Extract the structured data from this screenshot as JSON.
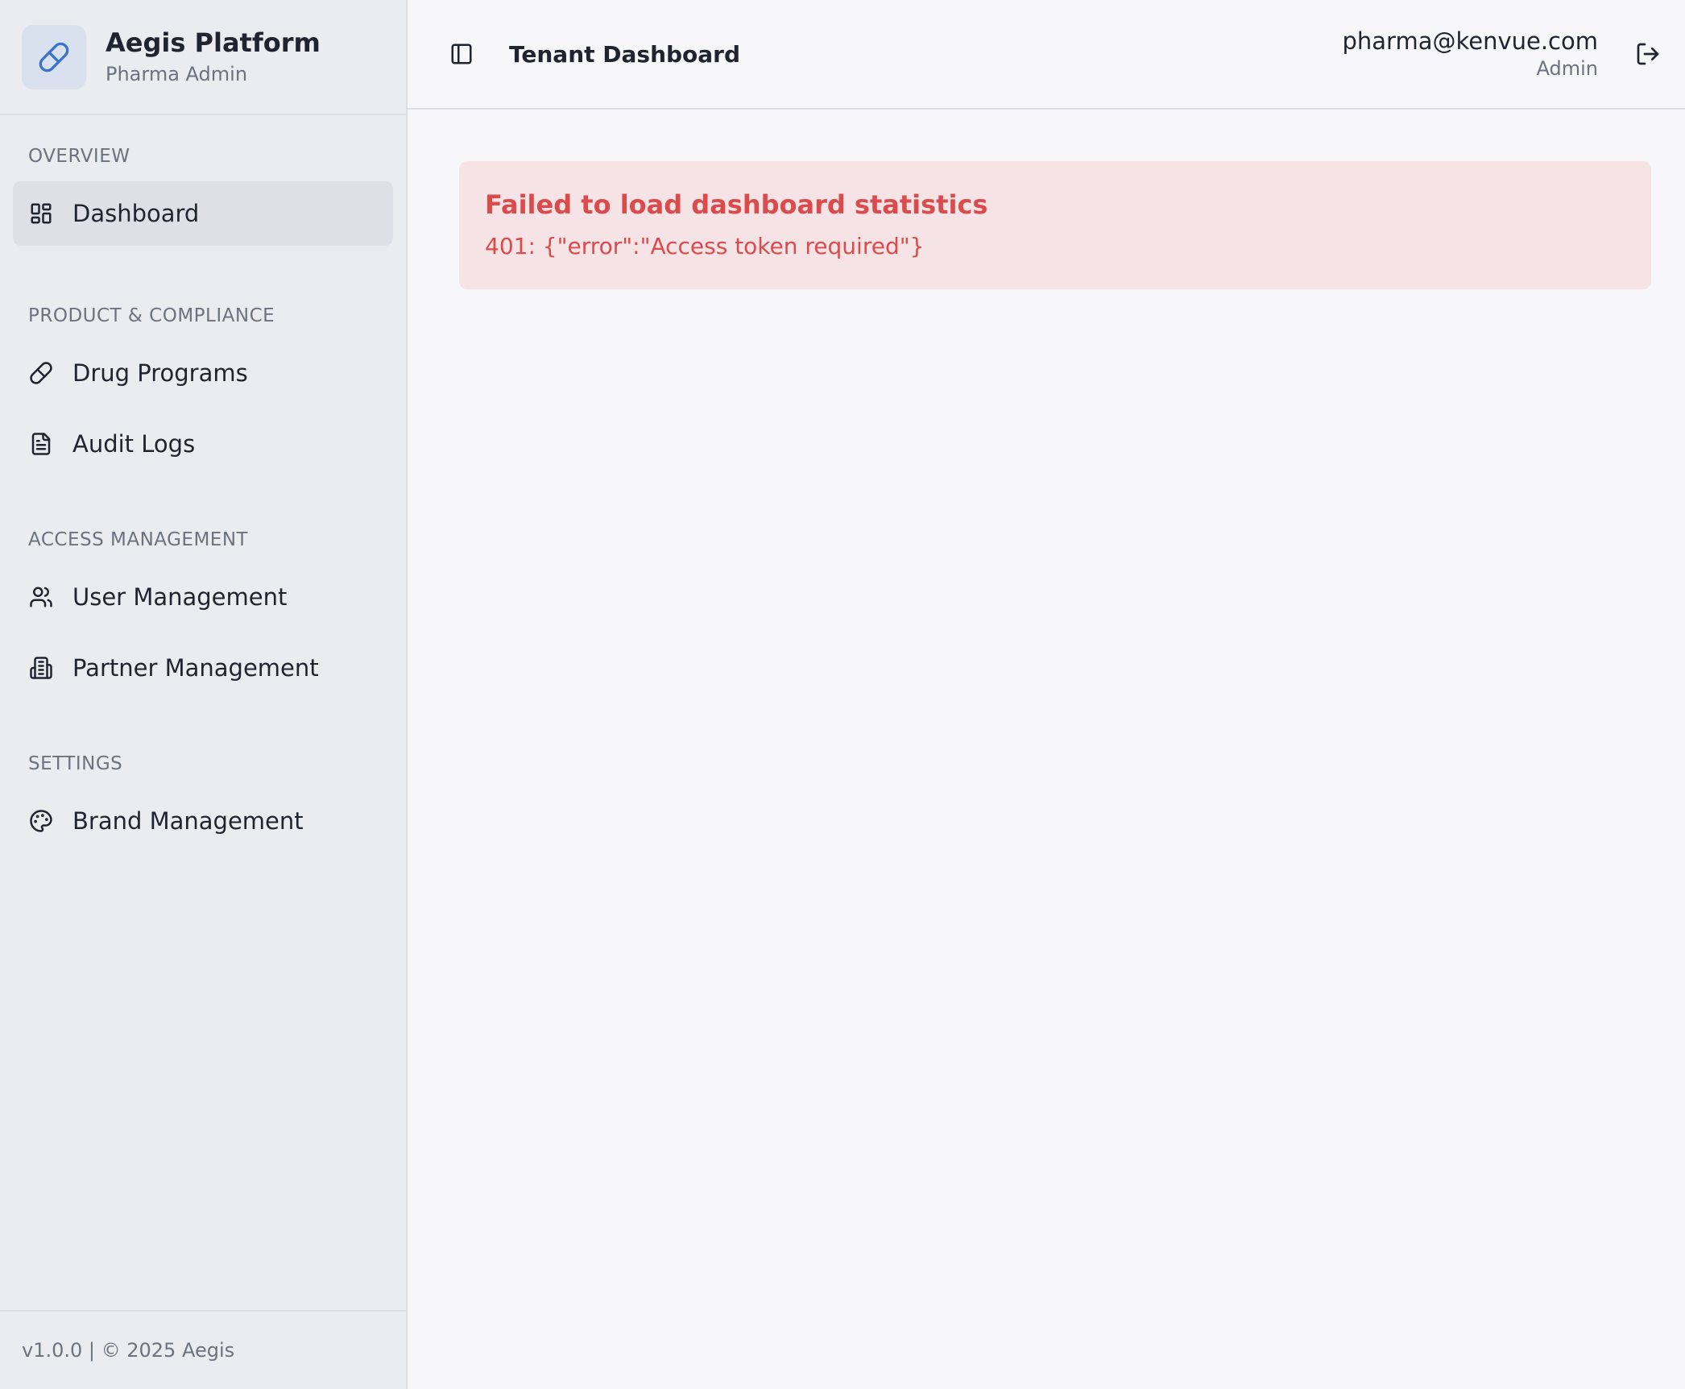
{
  "brand": {
    "title": "Aegis Platform",
    "subtitle": "Pharma Admin",
    "logo_icon": "pill-icon",
    "accent_color": "#3b73c8"
  },
  "sidebar": {
    "sections": [
      {
        "label": "OVERVIEW",
        "items": [
          {
            "label": "Dashboard",
            "icon": "dashboard-grid-icon",
            "active": true
          }
        ]
      },
      {
        "label": "PRODUCT & COMPLIANCE",
        "items": [
          {
            "label": "Drug Programs",
            "icon": "pill-icon"
          },
          {
            "label": "Audit Logs",
            "icon": "document-icon"
          }
        ]
      },
      {
        "label": "ACCESS MANAGEMENT",
        "items": [
          {
            "label": "User Management",
            "icon": "users-icon"
          },
          {
            "label": "Partner Management",
            "icon": "building-icon"
          }
        ]
      },
      {
        "label": "SETTINGS",
        "items": [
          {
            "label": "Brand Management",
            "icon": "palette-icon"
          }
        ]
      }
    ],
    "footer": "v1.0.0 | © 2025 Aegis"
  },
  "header": {
    "title": "Tenant Dashboard",
    "toggle_icon": "sidebar-toggle-icon",
    "user_email": "pharma@kenvue.com",
    "user_role": "Admin",
    "logout_icon": "logout-icon"
  },
  "error": {
    "title": "Failed to load dashboard statistics",
    "message": "401: {\"error\":\"Access token required\"}",
    "color": "#dc4b4b",
    "background": "#f5e3e6"
  }
}
